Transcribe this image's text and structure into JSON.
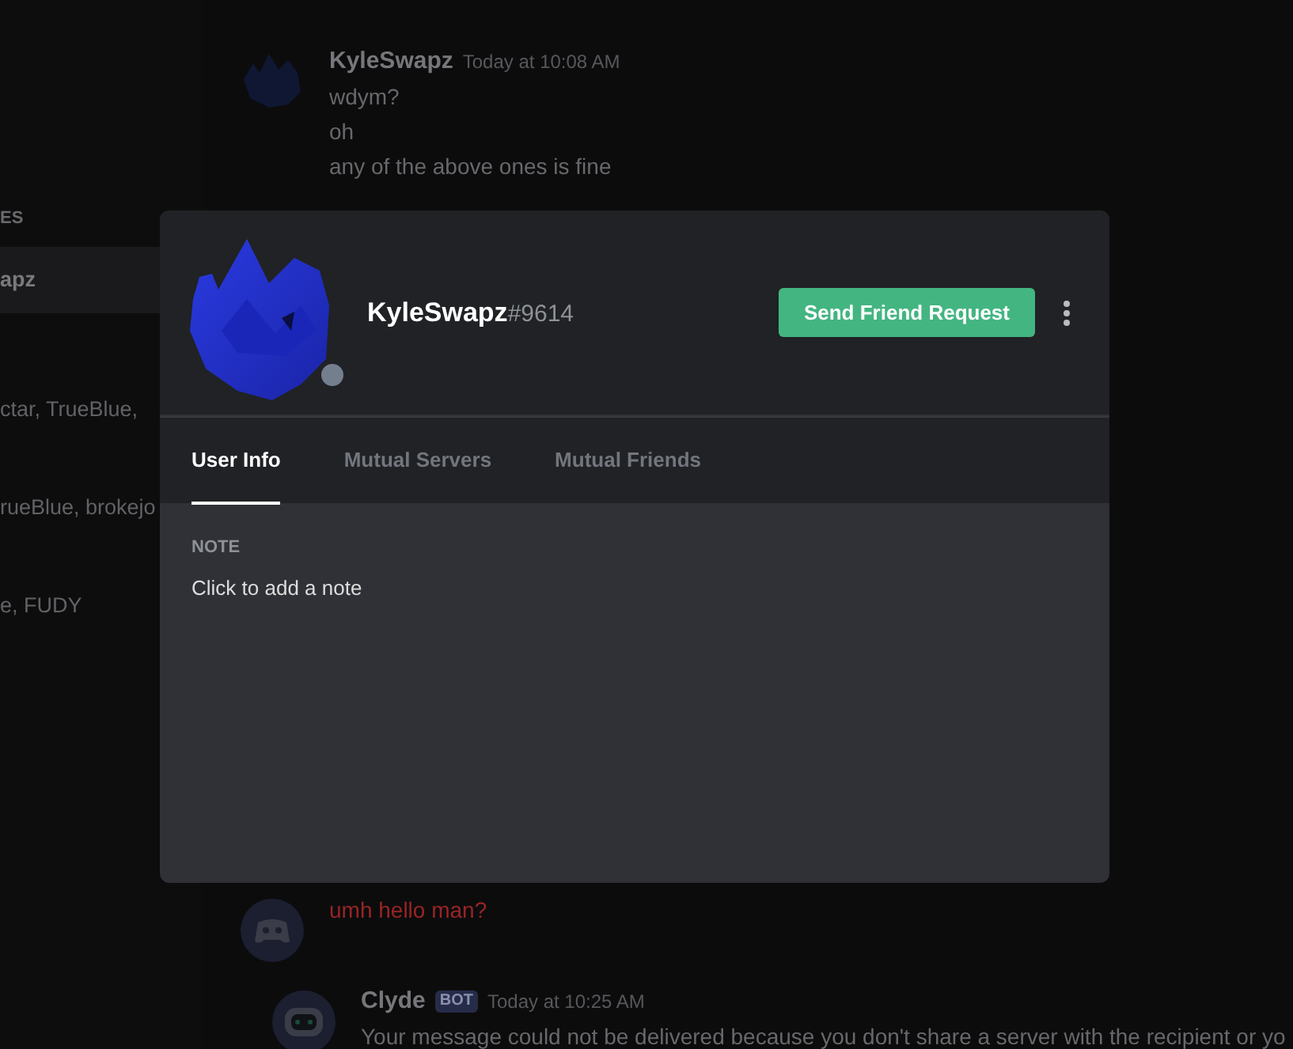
{
  "sidebar": {
    "section_label": "ES",
    "items": [
      {
        "label": "apz",
        "selected": true
      },
      {
        "label": "ctar, TrueBlue,",
        "selected": false
      },
      {
        "label": "rueBlue, brokejo",
        "selected": false
      },
      {
        "label": "e, FUDY",
        "selected": false
      }
    ]
  },
  "chat": {
    "messages": [
      {
        "kind": "user",
        "author": "KyleSwapz",
        "timestamp": "Today at 10:08 AM",
        "lines": [
          {
            "text": "wdym?",
            "failed": false
          },
          {
            "text": "oh",
            "failed": false
          },
          {
            "text": "any of the above ones is fine",
            "failed": false
          }
        ]
      },
      {
        "kind": "headless",
        "lines": [
          {
            "text": "umh hello man?",
            "failed": true
          }
        ]
      },
      {
        "kind": "bot",
        "author": "Clyde",
        "badge": "BOT",
        "timestamp": "Today at 10:25 AM",
        "lines": [
          {
            "text": "Your message could not be delivered because you don't share a server with the recipient or yo",
            "failed": false
          }
        ]
      }
    ]
  },
  "profile": {
    "username": "KyleSwapz",
    "discriminator": "#9614",
    "action": "Send Friend Request",
    "tabs": [
      {
        "label": "User Info",
        "selected": true
      },
      {
        "label": "Mutual Servers",
        "selected": false
      },
      {
        "label": "Mutual Friends",
        "selected": false
      }
    ],
    "note": {
      "label": "NOTE",
      "placeholder": "Click to add a note"
    }
  }
}
